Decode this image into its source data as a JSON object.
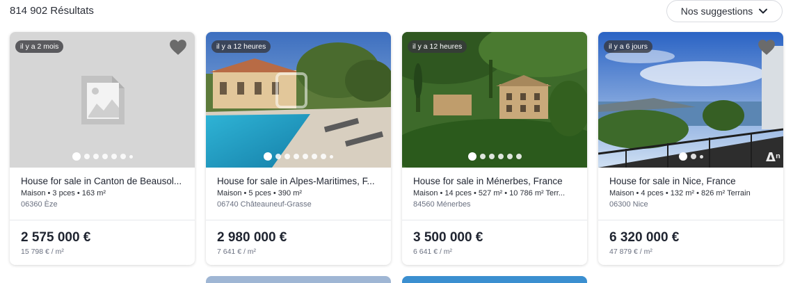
{
  "header": {
    "results_count": "814 902 Résultats",
    "sort_label": "Nos suggestions",
    "sort_icon": "chevron-down-icon"
  },
  "listings": [
    {
      "age": "il y a 2 mois",
      "title": "House for sale in Canton de Beausol...",
      "details": "Maison • 3 pces • 163 m²",
      "location": "06360 Èze",
      "price": "2 575 000 €",
      "price_per_m2": "15 798 € / m²",
      "image": "placeholder-image-icon",
      "photo_count": 7,
      "active_photo": 1
    },
    {
      "age": "il y a 12 heures",
      "title": "House for sale in Alpes-Maritimes, F...",
      "details": "Maison • 5 pces • 390 m²",
      "location": "06740 Châteauneuf-Grasse",
      "price": "2 980 000 €",
      "price_per_m2": "7 641 € / m²",
      "image": "villa-pool-photo",
      "photo_count": 8,
      "active_photo": 1
    },
    {
      "age": "il y a 12 heures",
      "title": "House for sale in Ménerbes, France",
      "details": "Maison • 14 pces • 527 m² • 10 786 m² Terr...",
      "location": "84560 Ménerbes",
      "price": "3 500 000 €",
      "price_per_m2": "6 641 € / m²",
      "image": "stone-house-hill-photo",
      "photo_count": 6,
      "active_photo": 1
    },
    {
      "age": "il y a 6 jours",
      "title": "House for sale in Nice, France",
      "details": "Maison • 4 pces • 132 m² • 826 m² Terrain",
      "location": "06300 Nice",
      "price": "6 320 000 €",
      "price_per_m2": "47 879 € / m²",
      "image": "sea-view-terrace-photo",
      "photo_count": 3,
      "active_photo": 1
    }
  ],
  "colors": {
    "text_primary": "#1f2430",
    "text_muted": "#6a7080",
    "card_border": "#e6e8ec",
    "badge_bg": "#37373c",
    "favorite_icon": "#6b6b6b"
  }
}
